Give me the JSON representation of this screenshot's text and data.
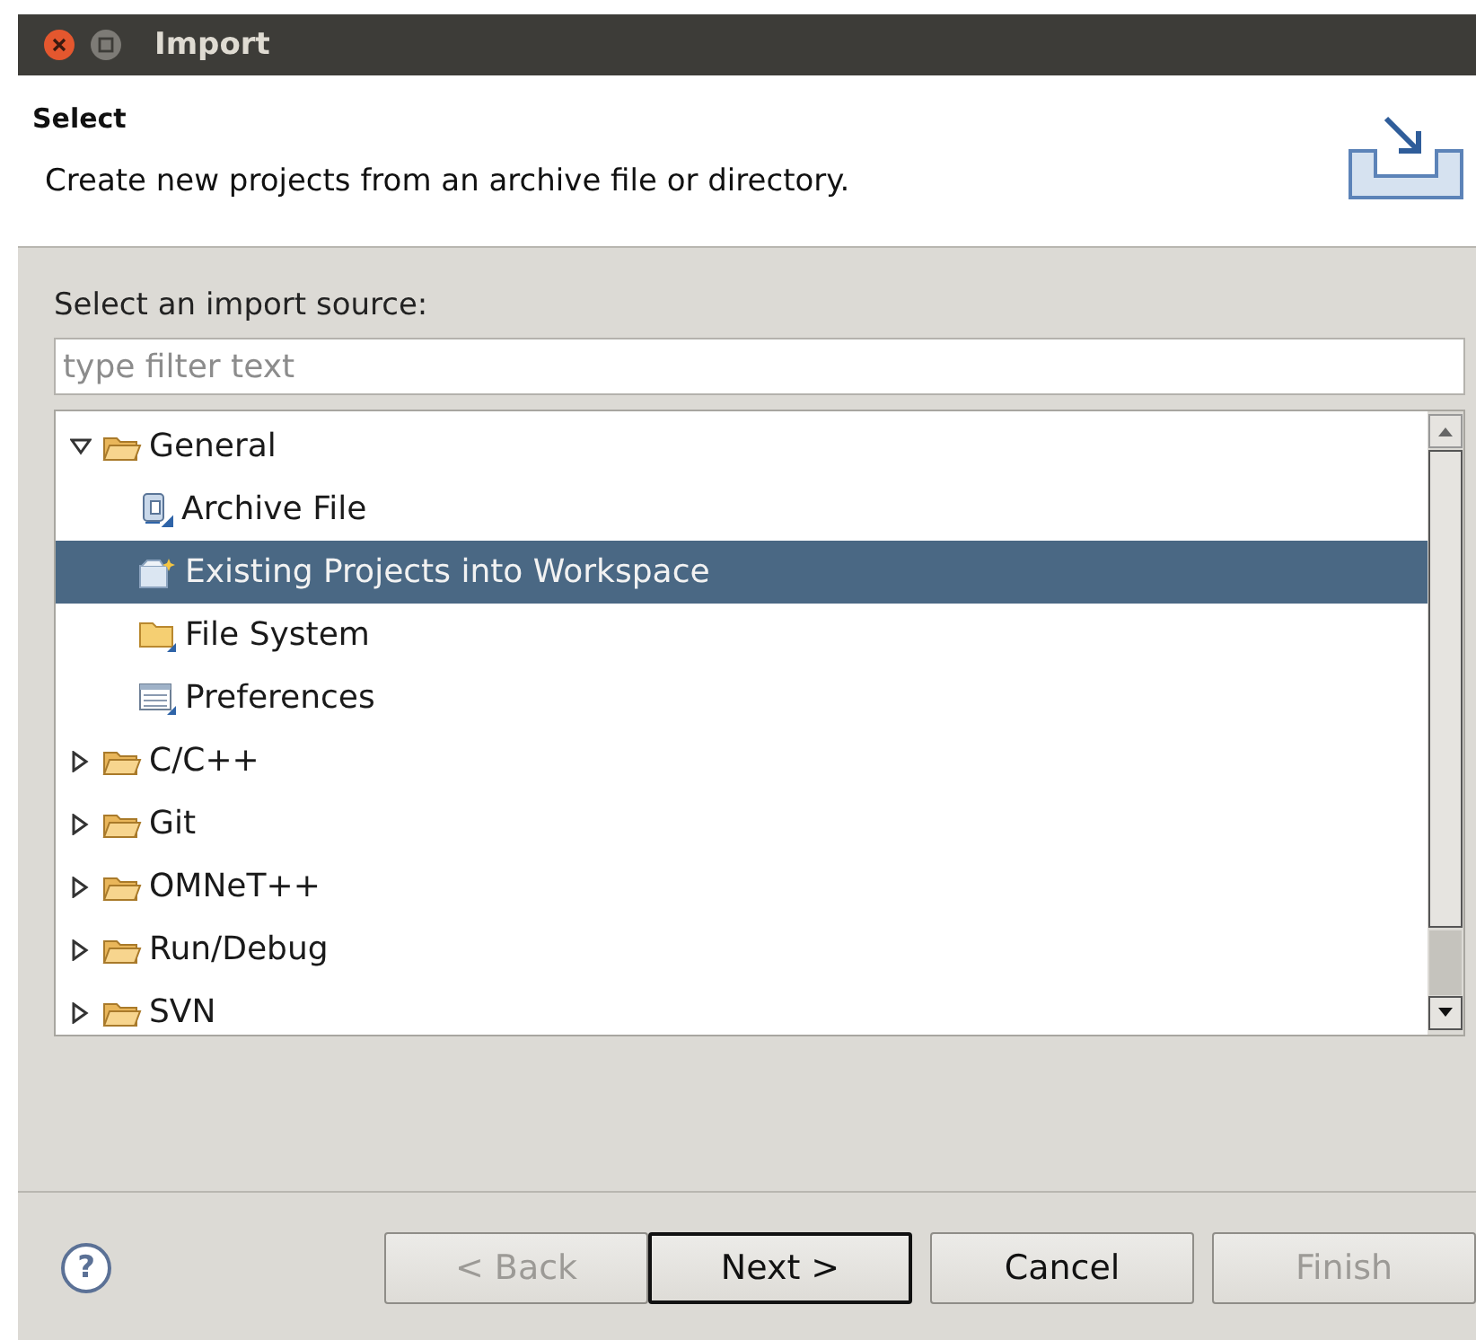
{
  "window": {
    "title": "Import"
  },
  "header": {
    "title": "Select",
    "description": "Create new projects from an archive file or directory."
  },
  "source_label": "Select an import source:",
  "filter": {
    "placeholder": "type filter text"
  },
  "tree": [
    {
      "label": "General",
      "kind": "folder",
      "expanded": true,
      "selected": false,
      "children": [
        {
          "label": "Archive File",
          "kind": "archive",
          "selected": false
        },
        {
          "label": "Existing Projects into Workspace",
          "kind": "project",
          "selected": true
        },
        {
          "label": "File System",
          "kind": "filesystem",
          "selected": false
        },
        {
          "label": "Preferences",
          "kind": "preferences",
          "selected": false
        }
      ]
    },
    {
      "label": "C/C++",
      "kind": "folder",
      "expanded": false,
      "selected": false
    },
    {
      "label": "Git",
      "kind": "folder",
      "expanded": false,
      "selected": false
    },
    {
      "label": "OMNeT++",
      "kind": "folder",
      "expanded": false,
      "selected": false
    },
    {
      "label": "Run/Debug",
      "kind": "folder",
      "expanded": false,
      "selected": false
    },
    {
      "label": "SVN",
      "kind": "folder",
      "expanded": false,
      "selected": false
    }
  ],
  "help_button": "?",
  "buttons": [
    {
      "label": "< Back",
      "disabled": true,
      "default": false
    },
    {
      "label": "Next >",
      "disabled": false,
      "default": true
    },
    {
      "label": "Cancel",
      "disabled": false,
      "default": false
    },
    {
      "label": "Finish",
      "disabled": true,
      "default": false
    }
  ]
}
